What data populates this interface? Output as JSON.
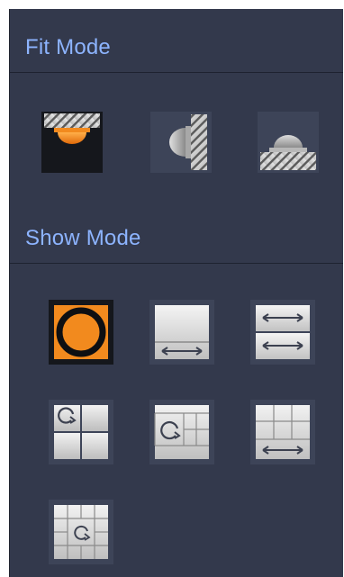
{
  "fit_mode": {
    "title": "Fit Mode",
    "buttons": [
      {
        "name": "ceiling-mount",
        "icon": "ceiling-mount-icon",
        "selected": true
      },
      {
        "name": "wall-mount",
        "icon": "wall-mount-icon",
        "selected": false
      },
      {
        "name": "ground-mount",
        "icon": "ground-mount-icon",
        "selected": false
      }
    ]
  },
  "show_mode": {
    "title": "Show Mode",
    "buttons": [
      {
        "name": "original-fisheye",
        "icon": "fisheye-original-icon",
        "selected": true
      },
      {
        "name": "single-panorama",
        "icon": "panorama-single-icon",
        "selected": false
      },
      {
        "name": "dual-panorama",
        "icon": "panorama-dual-icon",
        "selected": false
      },
      {
        "name": "fisheye-plus-3",
        "icon": "fisheye-plus-3-icon",
        "selected": false
      },
      {
        "name": "fisheye-plus-4",
        "icon": "fisheye-plus-4-icon",
        "selected": false
      },
      {
        "name": "panorama-plus-6",
        "icon": "panorama-plus-6-icon",
        "selected": false
      },
      {
        "name": "fisheye-plus-8",
        "icon": "fisheye-plus-8-icon",
        "selected": false
      }
    ]
  },
  "colors": {
    "panel_bg": "#33394c",
    "title_text": "#8db4ff",
    "accent_orange": "#f28a1e",
    "selected_bg": "#15171c"
  }
}
